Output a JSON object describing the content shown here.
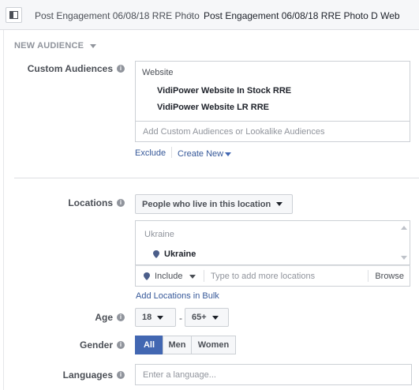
{
  "breadcrumb": {
    "parent": "Post Engagement 06/08/18 RRE Photo",
    "separator": ">",
    "current": "Post Engagement 06/08/18 RRE Photo D Web"
  },
  "new_audience_label": "NEW AUDIENCE",
  "custom_audiences": {
    "label": "Custom Audiences",
    "group": "Website",
    "items": [
      "VidiPower Website In Stock RRE",
      "VidiPower Website LR RRE"
    ],
    "placeholder": "Add Custom Audiences or Lookalike Audiences",
    "exclude": "Exclude",
    "create_new": "Create New"
  },
  "locations": {
    "label": "Locations",
    "type_dropdown": "People who live in this location",
    "group": "Ukraine",
    "items": [
      "Ukraine"
    ],
    "include": "Include",
    "placeholder": "Type to add more locations",
    "browse": "Browse",
    "bulk_link": "Add Locations in Bulk"
  },
  "age": {
    "label": "Age",
    "min": "18",
    "dash": "-",
    "max": "65+"
  },
  "gender": {
    "label": "Gender",
    "options": [
      "All",
      "Men",
      "Women"
    ],
    "selected": "All"
  },
  "languages": {
    "label": "Languages",
    "placeholder": "Enter a language..."
  },
  "colors": {
    "accent": "#4267b2",
    "link": "#365899"
  }
}
